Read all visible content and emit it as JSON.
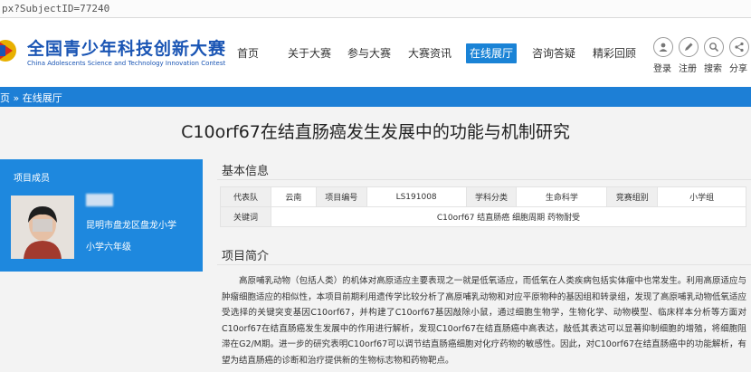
{
  "browser": {
    "url": "px?SubjectID=77240"
  },
  "header": {
    "brand_cn": "全国青少年科技创新大赛",
    "brand_en": "China Adolescents Science and Technology Innovation Contest",
    "nav": [
      "首页",
      "关于大赛",
      "参与大赛",
      "大赛资讯",
      "在线展厅",
      "咨询答疑",
      "精彩回顾"
    ],
    "active_nav": "在线展厅",
    "tools": [
      "登录",
      "注册",
      "搜索",
      "分享"
    ]
  },
  "breadcrumb": "页 » 在线展厅",
  "page_title": "C10orf67在结直肠癌发生发展中的功能与机制研究",
  "member": {
    "heading": "项目成员",
    "school": "昆明市盘龙区盘龙小学",
    "grade": "小学六年级"
  },
  "basic_info": {
    "title": "基本信息",
    "row1": [
      {
        "label": "代表队",
        "value": "云南"
      },
      {
        "label": "项目编号",
        "value": "LS191008"
      },
      {
        "label": "学科分类",
        "value": "生命科学"
      },
      {
        "label": "竞赛组别",
        "value": "小学组"
      }
    ],
    "keywords_label": "关键词",
    "keywords_value": "C10orf67 结直肠癌 细胞周期 药物耐受"
  },
  "summary": {
    "title": "项目简介",
    "text": "高原哺乳动物（包括人类）的机体对高原适应主要表现之一就是低氧适应，而低氧在人类疾病包括实体瘤中也常发生。利用高原适应与肿瘤细胞适应的相似性，本项目前期利用遗传学比较分析了高原哺乳动物和对应平原物种的基因组和转录组，发现了高原哺乳动物低氧适应受选择的关键突变基因C10orf67，并构建了C10orf67基因敲除小鼠，通过细胞生物学，生物化学、动物模型、临床样本分析等方面对C10orf67在结直肠癌发生发展中的作用进行解析，发现C10orf67在结直肠癌中高表达，敲低其表达可以显著抑制细胞的增殖，将细胞阻滞在G2/M期。进一步的研究表明C10orf67可以调节结直肠癌细胞对化疗药物的敏感性。因此，对C10orf67在结直肠癌中的功能解析，有望为结直肠癌的诊断和治疗提供新的生物标志物和药物靶点。"
  },
  "colors": {
    "brand_blue": "#1a55b4",
    "accent_blue": "#1d7fd6",
    "card_blue": "#1e88de"
  }
}
